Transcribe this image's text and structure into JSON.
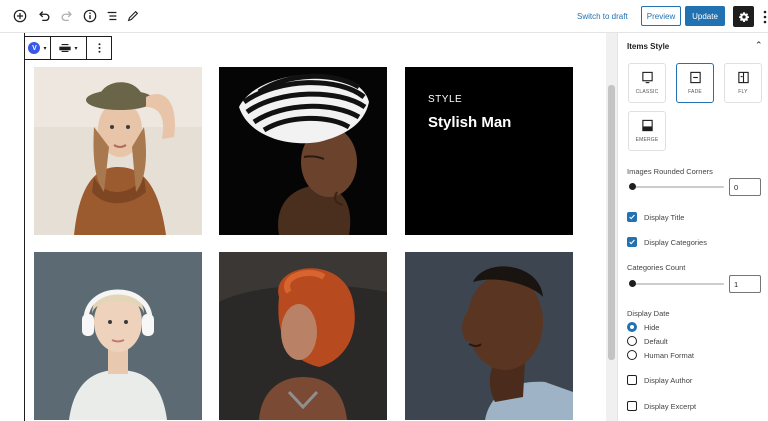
{
  "toolbar": {
    "icons": [
      "add-block-icon",
      "undo-icon",
      "redo-icon",
      "info-icon",
      "list-view-icon",
      "edit-tools-icon"
    ],
    "switch_to_draft": "Switch to draft",
    "preview": "Preview",
    "update": "Update"
  },
  "block_toolbar": {
    "block_icon": "V",
    "align_icon": "align-wide-icon",
    "more_icon": "more-vertical-icon"
  },
  "gallery": {
    "items": [
      {
        "description": "woman-hat-sweater"
      },
      {
        "description": "woman-striped-scarf"
      },
      {
        "description": "hover-overlay",
        "category": "STYLE",
        "title": "Stylish Man"
      },
      {
        "description": "woman-headphones"
      },
      {
        "description": "woman-red-hair"
      },
      {
        "description": "man-profile"
      }
    ]
  },
  "sidebar": {
    "panel_title": "Items Style",
    "styles": [
      {
        "label": "CLASSIC",
        "active": false
      },
      {
        "label": "FADE",
        "active": true
      },
      {
        "label": "FLY",
        "active": false
      },
      {
        "label": "EMERGE",
        "active": false
      }
    ],
    "rounded_corners_label": "Images Rounded Corners",
    "rounded_corners_value": "0",
    "display_title_label": "Display Title",
    "display_title_checked": true,
    "display_categories_label": "Display Categories",
    "display_categories_checked": true,
    "categories_count_label": "Categories Count",
    "categories_count_value": "1",
    "display_date_label": "Display Date",
    "date_options": [
      {
        "label": "Hide",
        "selected": true
      },
      {
        "label": "Default",
        "selected": false
      },
      {
        "label": "Human Format",
        "selected": false
      }
    ],
    "display_author_label": "Display Author",
    "display_author_checked": false,
    "display_excerpt_label": "Display Excerpt",
    "display_excerpt_checked": false
  },
  "colors": {
    "accent": "#2271b1",
    "block_logo": "#3858e9",
    "dark": "#1e1e1e"
  }
}
